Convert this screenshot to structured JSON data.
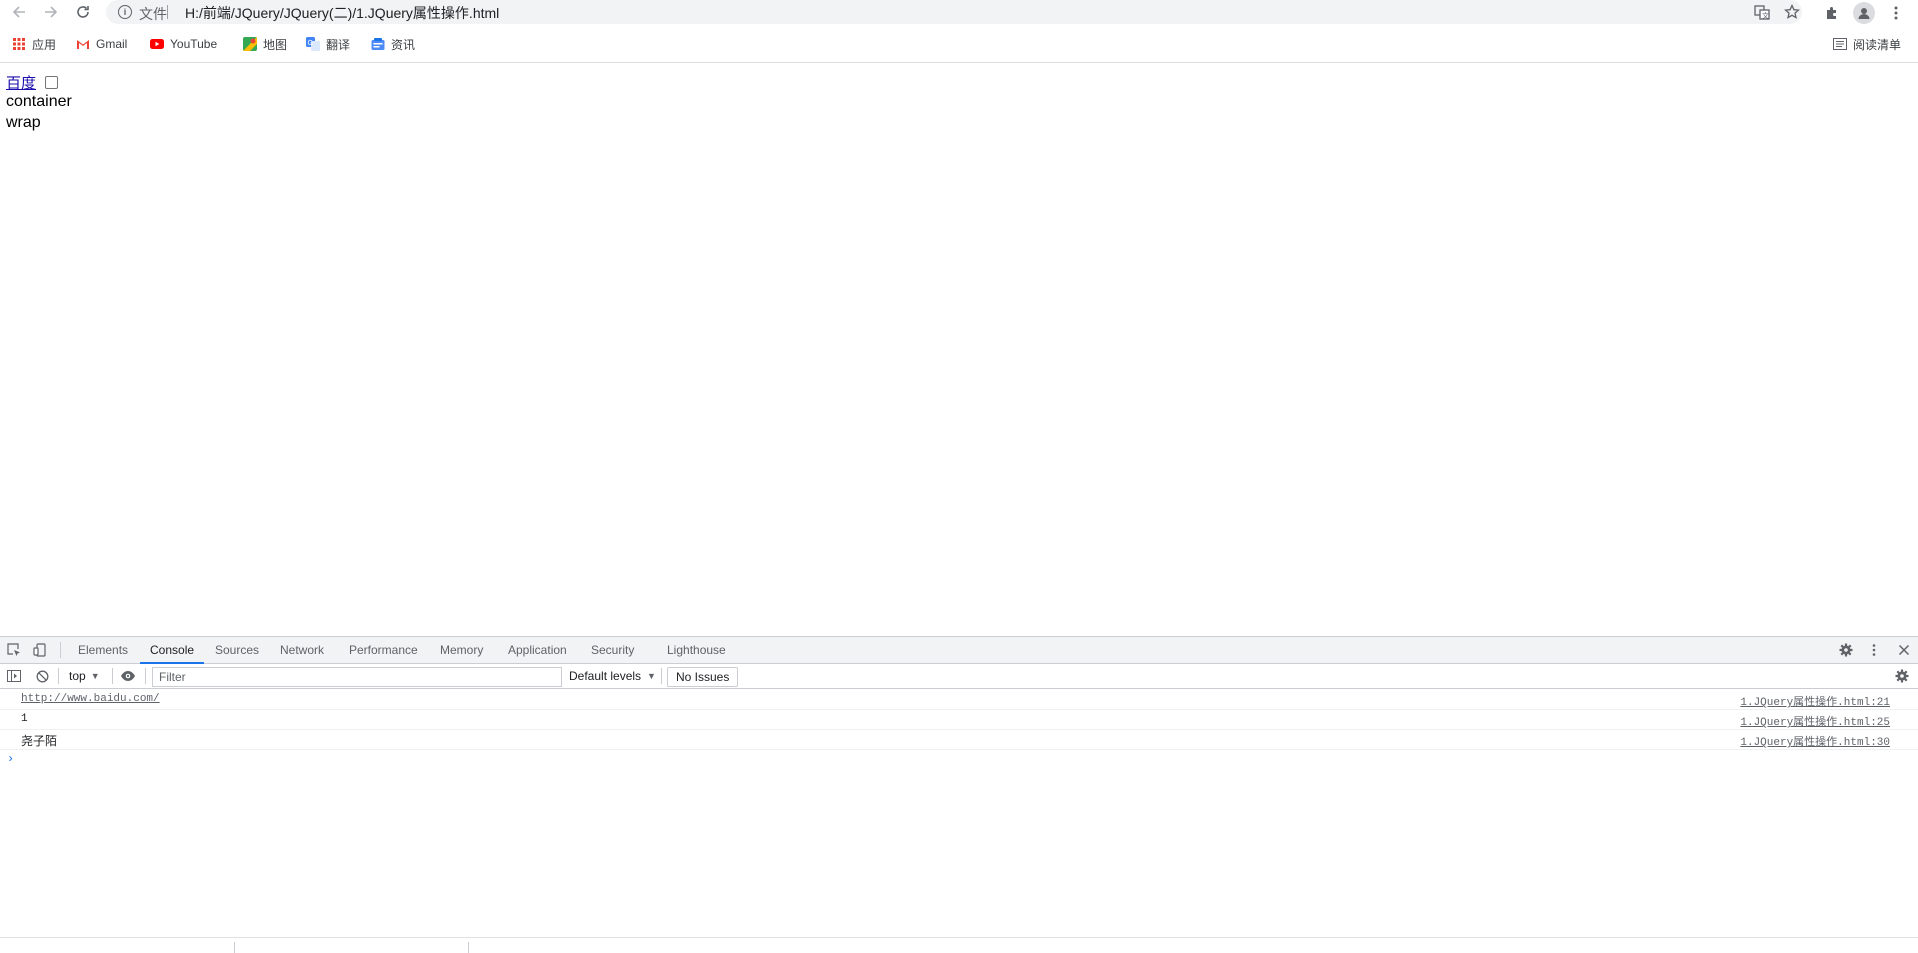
{
  "browser": {
    "address_scheme": "文件",
    "url": "H:/前端/JQuery/JQuery(二)/1.JQuery属性操作.html"
  },
  "bookmarks": {
    "items": [
      {
        "label": "应用",
        "icon": "apps-grid-icon"
      },
      {
        "label": "Gmail",
        "icon": "gmail-icon"
      },
      {
        "label": "YouTube",
        "icon": "youtube-icon"
      },
      {
        "label": "地图",
        "icon": "maps-icon"
      },
      {
        "label": "翻译",
        "icon": "translate-icon"
      },
      {
        "label": "资讯",
        "icon": "news-icon"
      }
    ],
    "reading_list": "阅读清单"
  },
  "page": {
    "link_text": "百度",
    "checkbox_checked": false,
    "line2": "container",
    "line3": "wrap"
  },
  "devtools": {
    "tabs": [
      "Elements",
      "Console",
      "Sources",
      "Network",
      "Performance",
      "Memory",
      "Application",
      "Security",
      "Lighthouse"
    ],
    "active_tab": "Console",
    "context": "top",
    "filter_placeholder": "Filter",
    "levels": "Default levels",
    "issues": "No Issues",
    "messages": [
      {
        "text": "http://www.baidu.com/",
        "source": "1.JQuery属性操作.html:21"
      },
      {
        "text": "1",
        "source": "1.JQuery属性操作.html:25"
      },
      {
        "text": "尧子陌",
        "source": "1.JQuery属性操作.html:30"
      }
    ],
    "prompt": "›"
  },
  "colors": {
    "accent": "#1a73e8",
    "link": "#1a0dab",
    "toolbar_bg": "#f1f3f4"
  }
}
